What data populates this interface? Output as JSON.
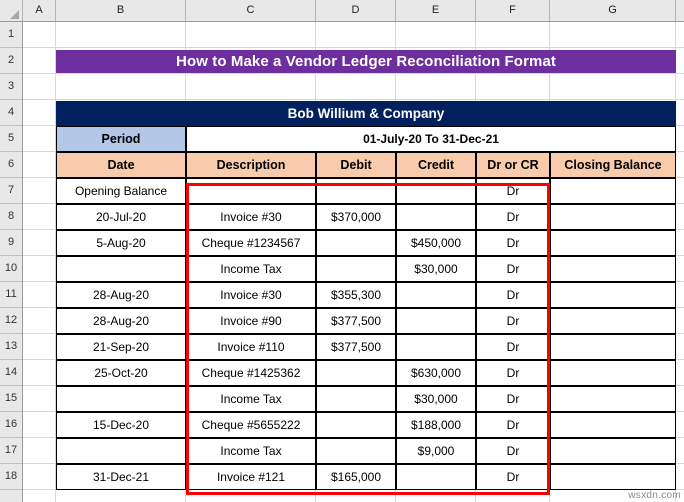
{
  "spreadsheet": {
    "column_headers": [
      "A",
      "B",
      "C",
      "D",
      "E",
      "F",
      "G"
    ],
    "row_headers": [
      "1",
      "2",
      "3",
      "4",
      "5",
      "6",
      "7",
      "8",
      "9",
      "10",
      "11",
      "12",
      "13",
      "14",
      "15",
      "16",
      "17",
      "18"
    ],
    "watermark": "wsxdn.com"
  },
  "colors": {
    "title_banner_bg": "#6E2F9E",
    "company_banner_bg": "#01215E",
    "period_label_bg": "#B4C7E7",
    "table_header_bg": "#F8CBAD",
    "selection_border": "#FF0000",
    "cell_bg": "#FFFFFF",
    "header_strip_bg": "#E8E8E8"
  },
  "title": "How to Make a Vendor Ledger Reconciliation Format",
  "company": "Bob Willium & Company",
  "period": {
    "label": "Period",
    "value": "01-July-20 To 31-Dec-21"
  },
  "table": {
    "headers": [
      "Date",
      "Description",
      "Debit",
      "Credit",
      "Dr or CR",
      "Closing Balance"
    ],
    "rows": [
      {
        "date": "Opening Balance",
        "description": "",
        "debit": "",
        "credit": "",
        "drcr": "Dr",
        "closing": ""
      },
      {
        "date": "20-Jul-20",
        "description": "Invoice #30",
        "debit": "$370,000",
        "credit": "",
        "drcr": "Dr",
        "closing": ""
      },
      {
        "date": "5-Aug-20",
        "description": "Cheque #1234567",
        "debit": "",
        "credit": "$450,000",
        "drcr": "Dr",
        "closing": ""
      },
      {
        "date": "",
        "description": "Income Tax",
        "debit": "",
        "credit": "$30,000",
        "drcr": "Dr",
        "closing": ""
      },
      {
        "date": "28-Aug-20",
        "description": "Invoice #30",
        "debit": "$355,300",
        "credit": "",
        "drcr": "Dr",
        "closing": ""
      },
      {
        "date": "28-Aug-20",
        "description": "Invoice #90",
        "debit": "$377,500",
        "credit": "",
        "drcr": "Dr",
        "closing": ""
      },
      {
        "date": "21-Sep-20",
        "description": "Invoice #110",
        "debit": "$377,500",
        "credit": "",
        "drcr": "Dr",
        "closing": ""
      },
      {
        "date": "25-Oct-20",
        "description": "Cheque #1425362",
        "debit": "",
        "credit": "$630,000",
        "drcr": "Dr",
        "closing": ""
      },
      {
        "date": "",
        "description": "Income Tax",
        "debit": "",
        "credit": "$30,000",
        "drcr": "Dr",
        "closing": ""
      },
      {
        "date": "15-Dec-20",
        "description": "Cheque #5655222",
        "debit": "",
        "credit": "$188,000",
        "drcr": "Dr",
        "closing": ""
      },
      {
        "date": "",
        "description": "Income Tax",
        "debit": "",
        "credit": "$9,000",
        "drcr": "Dr",
        "closing": ""
      },
      {
        "date": "31-Dec-21",
        "description": "Invoice #121",
        "debit": "$165,000",
        "credit": "",
        "drcr": "Dr",
        "closing": ""
      }
    ]
  }
}
